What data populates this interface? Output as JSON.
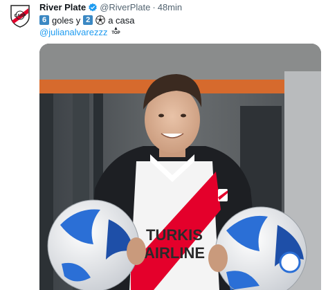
{
  "tweet": {
    "author_name": "River Plate",
    "author_handle": "@RiverPlate",
    "separator": "·",
    "time": "48min",
    "badge_goals": "6",
    "goals_text": "goles y",
    "badge_hat": "2",
    "home_text": "a casa",
    "mention": "@julianalvarezzz",
    "top_emoji_label": "TOP"
  },
  "media": {
    "jersey_sponsor_lines": [
      "TURKIS",
      "AIRLINE"
    ]
  },
  "colors": {
    "accent_link": "#1d9bf0",
    "verified": "#1d9bf0",
    "keycap": "#3b88c3",
    "club_red": "#e4002b"
  }
}
